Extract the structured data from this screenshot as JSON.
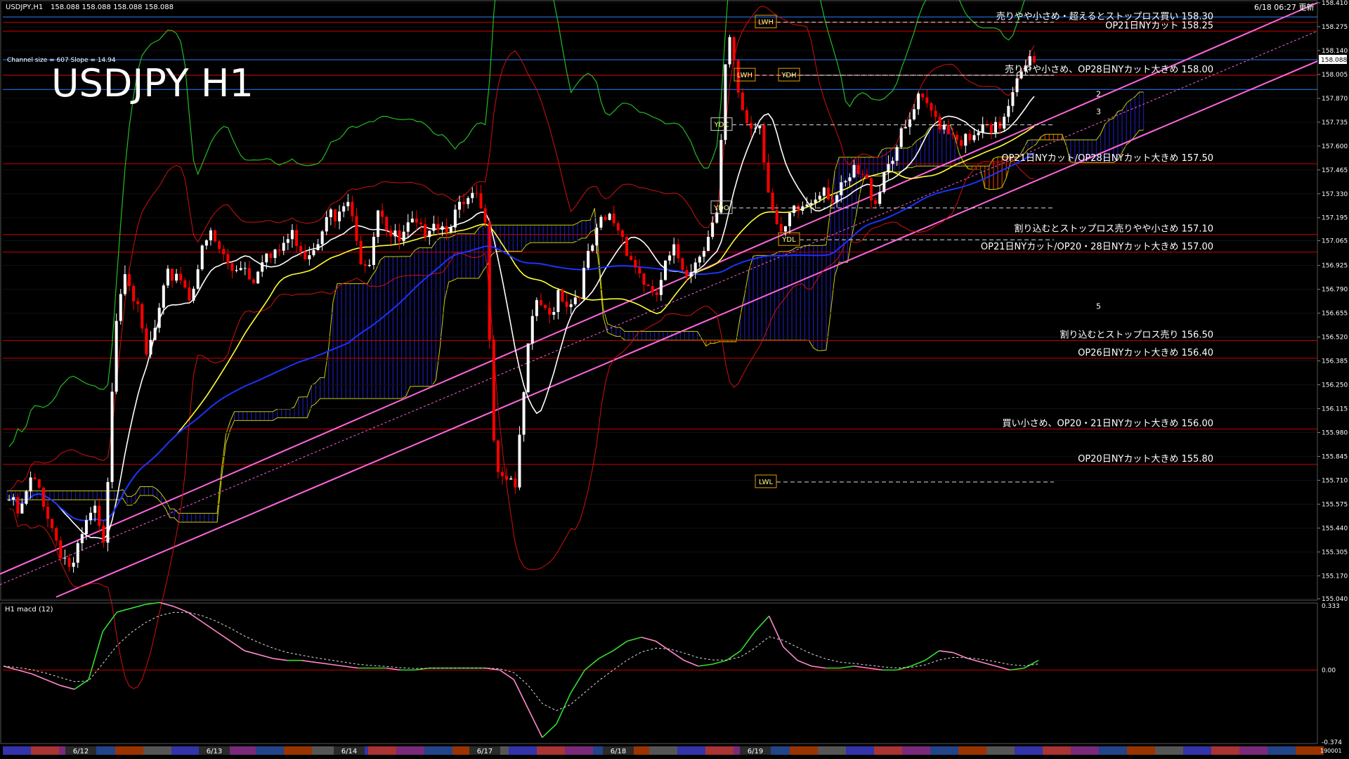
{
  "window": {
    "symbol_header": "USDJPY,H1",
    "header_prices": "158.088 158.088 158.088 158.088",
    "title": "USDJPY H1",
    "channel_info": "Channel size = 607 Slope = 14.94",
    "timestamp": "6/18 06:27 更新",
    "current_price": "158.088"
  },
  "colors": {
    "background": "#000000",
    "bull_candle": "#ffffff",
    "bear_candle": "#ff0000",
    "channel": "#ff66dd",
    "cloud_bull": "#2222cc",
    "cloud_bear": "#ff4400",
    "level_line": "#cc0000",
    "macd": "#ff88cc",
    "macd_signal": "#dddddd",
    "ma_white": "#ffffff",
    "ma_yellow": "#ffff33",
    "ma_blue": "#1a33ff",
    "bands": "#d01010",
    "green_line": "#22bb22"
  },
  "chart_data": {
    "type": "candlestick",
    "title": "USDJPY H1",
    "ylim": [
      155.04,
      158.41
    ],
    "y_ticks": [
      158.41,
      158.275,
      158.14,
      158.005,
      157.87,
      157.735,
      157.6,
      157.465,
      157.33,
      157.195,
      157.065,
      156.925,
      156.79,
      156.655,
      156.52,
      156.385,
      156.25,
      156.115,
      155.98,
      155.845,
      155.71,
      155.575,
      155.44,
      155.305,
      155.17,
      155.04
    ],
    "x_date_labels": [
      "6/12",
      "6/13",
      "6/14",
      "6/17",
      "6/18",
      "6/19"
    ],
    "price_path": [
      155.6,
      155.5,
      155.7,
      155.65,
      155.45,
      155.3,
      155.2,
      155.4,
      155.55,
      155.3,
      156.6,
      156.95,
      156.7,
      156.4,
      156.6,
      156.85,
      156.9,
      156.75,
      156.95,
      157.1,
      157.0,
      156.9,
      156.95,
      156.85,
      157.0,
      156.95,
      157.05,
      157.1,
      157.0,
      157.05,
      157.25,
      157.15,
      157.3,
      157.0,
      156.95,
      157.3,
      157.1,
      157.05,
      157.15,
      157.1,
      157.2,
      157.15,
      157.2,
      157.25,
      157.3,
      157.2,
      155.8,
      155.75,
      155.7,
      156.4,
      156.75,
      156.6,
      156.8,
      156.7,
      156.8,
      157.0,
      157.15,
      157.2,
      157.1,
      156.95,
      156.85,
      156.7,
      156.9,
      157.0,
      156.9,
      156.95,
      157.1,
      157.2,
      158.25,
      157.9,
      157.7,
      157.75,
      157.3,
      157.05,
      157.2,
      157.25,
      157.3,
      157.4,
      157.3,
      157.35,
      157.45,
      157.4,
      157.3,
      157.5,
      157.6,
      157.7,
      157.85,
      157.8,
      157.75,
      157.7,
      157.65,
      157.6,
      157.7,
      157.65,
      157.75,
      157.95,
      158.1,
      158.05
    ],
    "levels": [
      {
        "label": "売りやや小さめ・超えるとストップロス買い 158.30",
        "price": 158.3
      },
      {
        "label": "OP21日NYカット 158.25",
        "price": 158.25
      },
      {
        "label": "売りやや小さめ、OP28日NYカット大きめ 158.00",
        "price": 158.0
      },
      {
        "label": "OP21日NYカット/OP28日NYカット大きめ 157.50",
        "price": 157.5
      },
      {
        "label": "割り込むとストップロス売りやや小さめ 157.10",
        "price": 157.1
      },
      {
        "label": "OP21日NYカット/OP20・28日NYカット大きめ 157.00",
        "price": 157.0
      },
      {
        "label": "割り込むとストップロス売り 156.50",
        "price": 156.5
      },
      {
        "label": "OP26日NYカット大きめ 156.40",
        "price": 156.4
      },
      {
        "label": "買い小さめ、OP20・21日NYカット大きめ 156.00",
        "price": 156.0
      },
      {
        "label": "OP20日NYカット大きめ 155.80",
        "price": 155.8
      }
    ],
    "ref_labels": [
      {
        "label": "LWH",
        "price": 158.3
      },
      {
        "label": "LWH",
        "price": 158.0
      },
      {
        "label": "YDH",
        "price": 158.0
      },
      {
        "label": "YDC",
        "price": 157.72
      },
      {
        "label": "YDO",
        "price": 157.25
      },
      {
        "label": "YDL",
        "price": 157.07
      },
      {
        "label": "LWL",
        "price": 155.7
      }
    ],
    "wave_labels": [
      "2",
      "3",
      "5"
    ]
  },
  "macd": {
    "title": "H1  macd (12)",
    "ylim": [
      -0.374,
      0.333
    ],
    "y_ticks": [
      "0.333",
      "0.00",
      "-0.374"
    ],
    "values": [
      0.02,
      0.0,
      -0.02,
      -0.05,
      -0.08,
      -0.1,
      -0.05,
      0.2,
      0.3,
      0.32,
      0.34,
      0.35,
      0.33,
      0.3,
      0.25,
      0.2,
      0.15,
      0.1,
      0.08,
      0.06,
      0.05,
      0.05,
      0.04,
      0.03,
      0.02,
      0.01,
      0.01,
      0.01,
      0.0,
      0.0,
      0.01,
      0.01,
      0.01,
      0.01,
      0.01,
      0.0,
      -0.05,
      -0.2,
      -0.35,
      -0.28,
      -0.12,
      0.0,
      0.06,
      0.1,
      0.15,
      0.17,
      0.15,
      0.1,
      0.05,
      0.02,
      0.03,
      0.05,
      0.1,
      0.2,
      0.28,
      0.12,
      0.05,
      0.02,
      0.01,
      0.01,
      0.02,
      0.01,
      0.0,
      0.0,
      0.02,
      0.05,
      0.1,
      0.09,
      0.06,
      0.04,
      0.02,
      0.0,
      0.01,
      0.05
    ],
    "right_footer": "190001"
  }
}
